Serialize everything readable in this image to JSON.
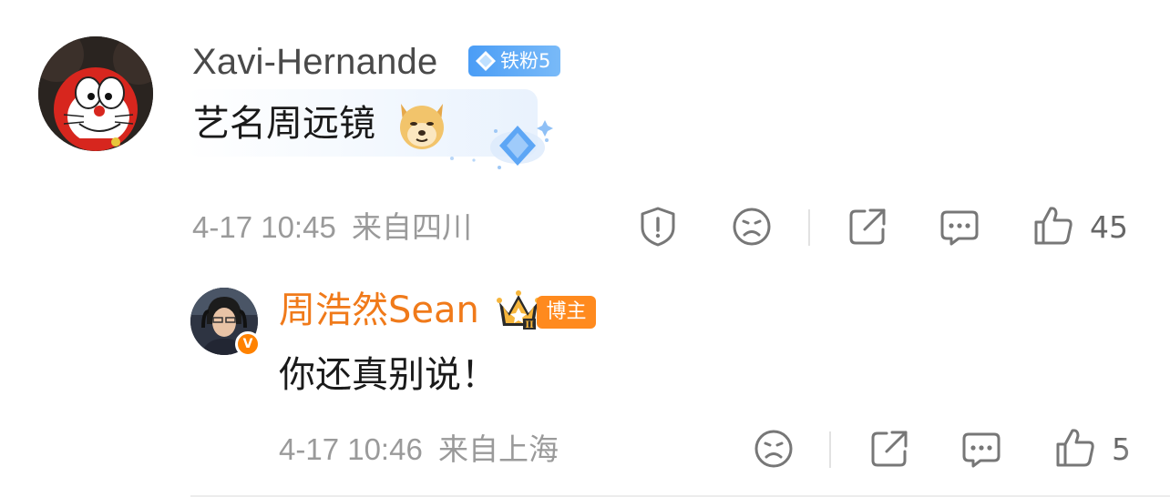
{
  "main_comment": {
    "username": "Xavi-Hernande",
    "fan_badge": "铁粉5",
    "text": "艺名周远镜",
    "emoji": "doge-emoji",
    "time": "4-17 10:45",
    "location": "来自四川",
    "like_count": "45",
    "actions": [
      "report-icon",
      "dislike-icon",
      "share-icon",
      "comment-icon",
      "like-icon"
    ]
  },
  "reply": {
    "username": "周浩然Sean",
    "crown_level": "II",
    "role_badge": "博主",
    "verified": "V",
    "text": "你还真别说！",
    "time": "4-17 10:46",
    "location": "来自上海",
    "like_count": "5",
    "actions": [
      "dislike-icon",
      "share-icon",
      "comment-icon",
      "like-icon"
    ]
  },
  "colors": {
    "username_reply": "#f07a1a",
    "fan_badge": "#4a9df6",
    "blogger_badge": "#ff8a1e",
    "meta_text": "#9a9a9a"
  }
}
